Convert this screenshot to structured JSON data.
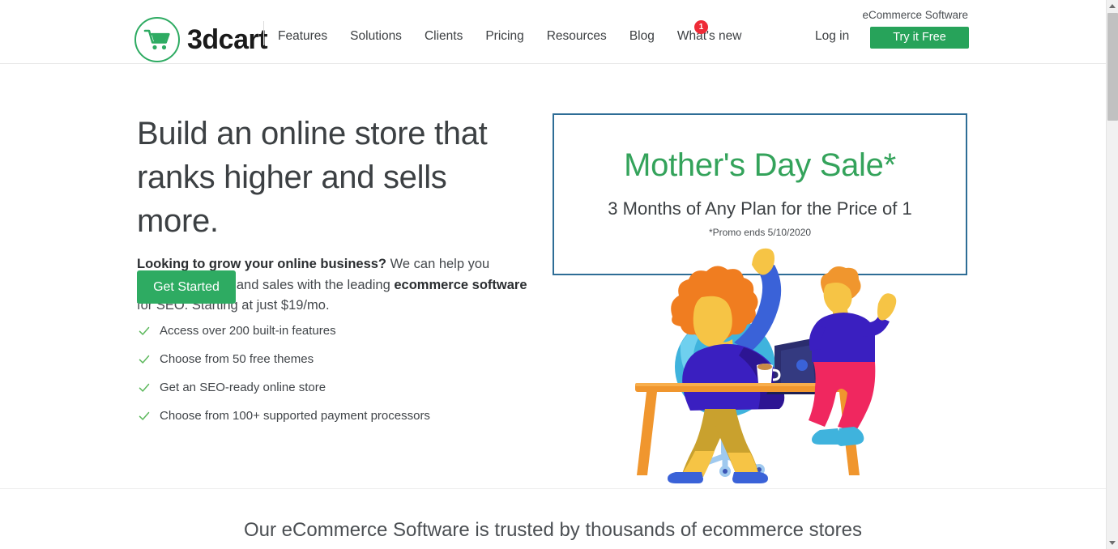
{
  "header": {
    "logo": {
      "icon": "shopping-cart-icon",
      "wordmark": "3dcart",
      "circle_color": "#2eab62"
    },
    "nav_items": [
      {
        "label": "Features"
      },
      {
        "label": "Solutions"
      },
      {
        "label": "Clients"
      },
      {
        "label": "Pricing"
      },
      {
        "label": "Resources"
      },
      {
        "label": "Blog"
      },
      {
        "label": "What's new"
      }
    ],
    "nav_badge": "1",
    "nav_badge_color": "#ee2b37",
    "tagline": "eCommerce Software",
    "login_label": "Log in",
    "cta_label": "Try it Free",
    "cta_color": "#27a35a"
  },
  "hero": {
    "title": "Build an online store that ranks higher and sells more.",
    "subtitle": {
      "bold_lead": "Looking to grow your online business?",
      "mid_1": " We can help you increase visitors and sales with the leading ",
      "bold_mid": "ecommerce software",
      "mid_2": " for SEO. Starting at just $19/mo."
    },
    "cta_label": "Get Started",
    "cta_color": "#2eab62",
    "features": [
      {
        "icon": "check-icon",
        "label": "Access over 200 built-in features"
      },
      {
        "icon": "check-icon",
        "label": "Choose from 50 free themes"
      },
      {
        "icon": "check-icon",
        "label": "Get an SEO-ready online store"
      },
      {
        "icon": "check-icon",
        "label": "Choose from 100+ supported payment processors"
      }
    ],
    "check_color": "#5cb85c"
  },
  "promo": {
    "title": "Mother's Day Sale*",
    "title_color": "#34a35b",
    "subtitle": "3 Months of Any Plan for the Price of 1",
    "fine_print": "*Promo ends 5/10/2020",
    "border_color": "#2e6d96"
  },
  "illustration": {
    "name": "woman-at-desk-with-child-illustration"
  },
  "trust": {
    "text": "Our eCommerce Software is trusted by thousands of ecommerce stores"
  },
  "scrollbar": {
    "up_arrow": "scroll-up-arrow-icon",
    "down_arrow": "scroll-down-arrow-icon"
  }
}
